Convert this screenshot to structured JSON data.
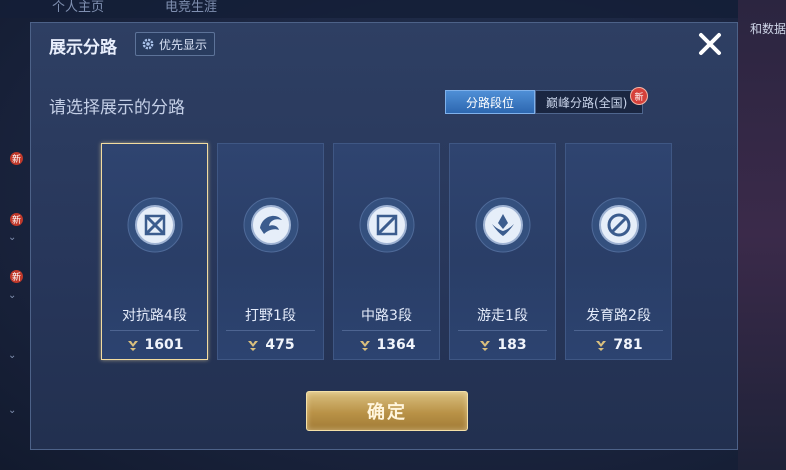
{
  "background": {
    "tabs": [
      "个人主页",
      "电竞生涯"
    ],
    "right_text": "和数据",
    "badge_text": "新"
  },
  "dialog": {
    "title": "展示分路",
    "priority_label": "优先显示",
    "subtitle": "请选择展示的分路",
    "toggle": {
      "active": "分路段位",
      "inactive": "巅峰分路(全国)",
      "new_badge": "新"
    },
    "lanes": [
      {
        "name": "对抗路4段",
        "score": "1601",
        "icon": "clash-lane-icon",
        "selected": true
      },
      {
        "name": "打野1段",
        "score": "475",
        "icon": "jungle-icon",
        "selected": false
      },
      {
        "name": "中路3段",
        "score": "1364",
        "icon": "mid-lane-icon",
        "selected": false
      },
      {
        "name": "游走1段",
        "score": "183",
        "icon": "roam-icon",
        "selected": false
      },
      {
        "name": "发育路2段",
        "score": "781",
        "icon": "farm-lane-icon",
        "selected": false
      }
    ],
    "confirm_label": "确定",
    "close_icon": "close-icon"
  },
  "colors": {
    "accent_blue": "#2d67b0",
    "gold": "#b99247",
    "selected_border": "#f2dca0"
  }
}
